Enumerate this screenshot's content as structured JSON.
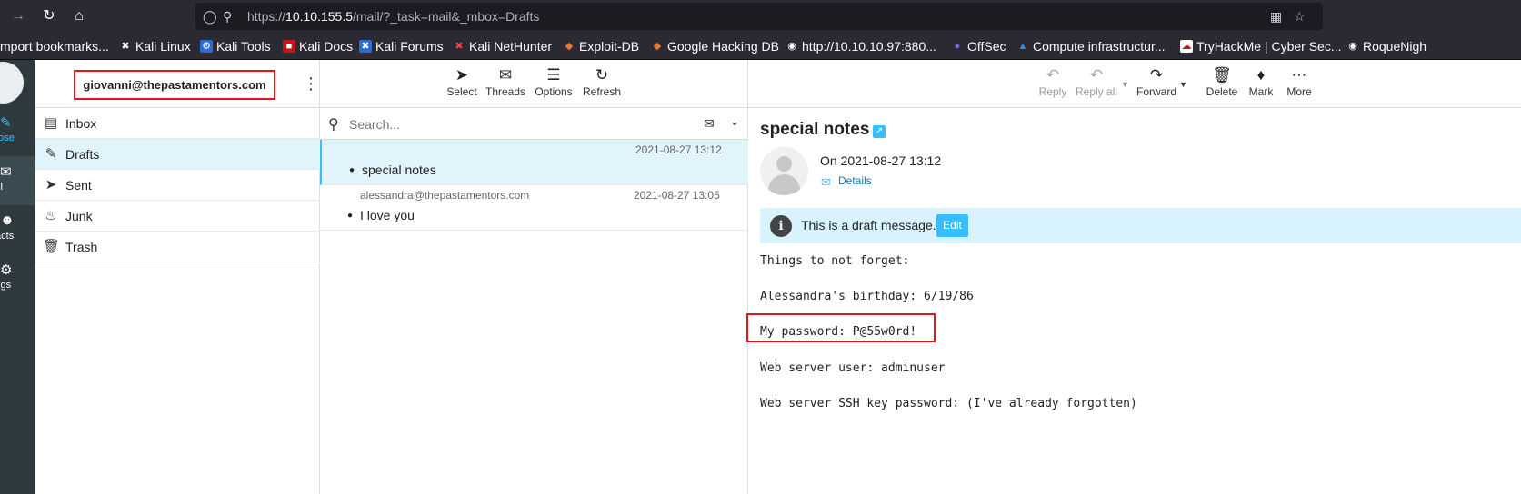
{
  "browser": {
    "url_prefix": "https://",
    "url_host": "10.10.155.5",
    "url_path": "/mail/?_task=mail&_mbox=Drafts"
  },
  "bookmarks": [
    {
      "label": "mport bookmarks...",
      "icon": "import-icon"
    },
    {
      "label": "Kali Linux",
      "icon": "kali-dragon-icon"
    },
    {
      "label": "Kali Tools",
      "icon": "kali-tools-icon"
    },
    {
      "label": "Kali Docs",
      "icon": "kali-docs-icon"
    },
    {
      "label": "Kali Forums",
      "icon": "kali-forums-icon"
    },
    {
      "label": "Kali NetHunter",
      "icon": "nethunter-icon"
    },
    {
      "label": "Exploit-DB",
      "icon": "exploit-db-icon"
    },
    {
      "label": "Google Hacking DB",
      "icon": "ghdb-icon"
    },
    {
      "label": "http://10.10.10.97:880...",
      "icon": "globe-icon"
    },
    {
      "label": "OffSec",
      "icon": "offsec-icon"
    },
    {
      "label": "Compute infrastructur...",
      "icon": "azure-icon"
    },
    {
      "label": "TryHackMe | Cyber Sec...",
      "icon": "tryhackme-icon"
    },
    {
      "label": "RoqueNigh",
      "icon": "github-icon"
    }
  ],
  "rail": {
    "compose": "pose",
    "mail": "ail",
    "contacts": "tacts",
    "settings": "ings"
  },
  "account": "giovanni@thepastamentors.com",
  "folders": [
    {
      "label": "Inbox",
      "icon": "inbox-icon"
    },
    {
      "label": "Drafts",
      "icon": "pencil-icon"
    },
    {
      "label": "Sent",
      "icon": "paper-plane-icon"
    },
    {
      "label": "Junk",
      "icon": "fire-icon"
    },
    {
      "label": "Trash",
      "icon": "trash-icon"
    }
  ],
  "list_toolbar": {
    "select": "Select",
    "threads": "Threads",
    "options": "Options",
    "refresh": "Refresh"
  },
  "search": {
    "placeholder": "Search..."
  },
  "messages": [
    {
      "from": "",
      "date": "2021-08-27 13:12",
      "subject": "special notes"
    },
    {
      "from": "alessandra@thepastamentors.com",
      "date": "2021-08-27 13:05",
      "subject": "I love you"
    }
  ],
  "preview_toolbar": {
    "reply": "Reply",
    "reply_all": "Reply all",
    "forward": "Forward",
    "delete": "Delete",
    "mark": "Mark",
    "more": "More"
  },
  "message": {
    "title": "special notes",
    "date": "On 2021-08-27 13:12",
    "details": "Details",
    "draft_notice": "This is a draft message.",
    "edit": "Edit",
    "body": [
      "Things to not forget:",
      "Alessandra's birthday: 6/19/86",
      "My password: P@55w0rd!",
      "Web server user: adminuser",
      "Web server SSH key password: (I've already forgotten)"
    ]
  },
  "colors": {
    "accent": "#37beff",
    "highlight_box": "#e8121d",
    "rail": "#2f3a3f"
  }
}
